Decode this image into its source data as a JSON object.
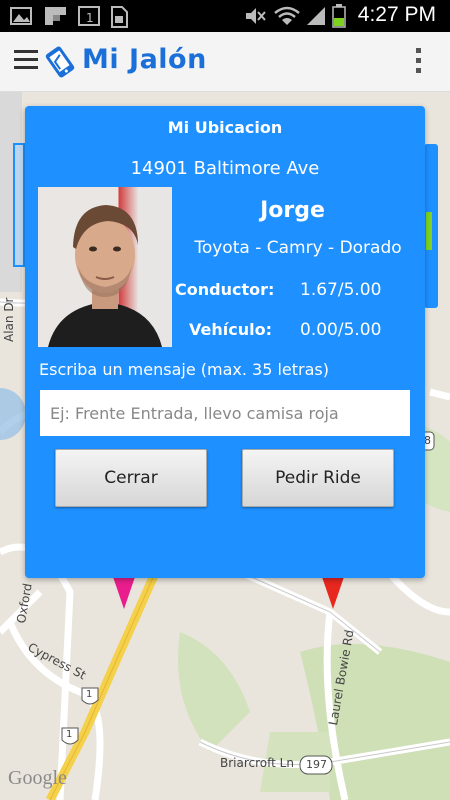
{
  "status_bar": {
    "time": "4:27 PM"
  },
  "app_bar": {
    "title": "Mi Jalón"
  },
  "map": {
    "labels": {
      "alan_dr": "Alan Dr",
      "oxford": "Oxford",
      "cypress_st": "Cypress St",
      "laurel_bowie_rd": "Laurel Bowie Rd",
      "briarcroft_ln": "Briarcroft Ln",
      "route_1a": "1",
      "route_1b": "1",
      "route_197": "197",
      "route_8": "8"
    },
    "attribution": "Google"
  },
  "dialog": {
    "title": "Mi Ubicacion",
    "address": "14901 Baltimore Ave",
    "driver_name": "Jorge",
    "vehicle": "Toyota - Camry - Dorado",
    "driver_rating_label": "Conductor:",
    "driver_rating_value": "1.67/5.00",
    "vehicle_rating_label": "Vehículo:",
    "vehicle_rating_value": "0.00/5.00",
    "message_label": "Escriba un mensaje (max. 35 letras)",
    "message_placeholder": "Ej: Frente Entrada, llevo camisa roja",
    "message_value": "",
    "close_button": "Cerrar",
    "request_button": "Pedir Ride"
  }
}
